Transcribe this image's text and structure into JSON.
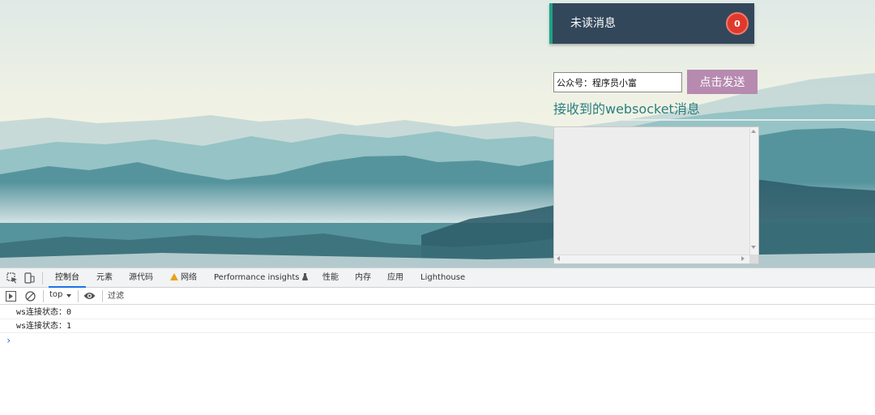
{
  "page": {
    "unread": {
      "label": "未读消息",
      "count": "0"
    },
    "input": {
      "value": "公众号：程序员小富"
    },
    "send_button": "点击发送",
    "received_title": "接收到的websocket消息",
    "message_area": {
      "value": ""
    }
  },
  "devtools": {
    "tabs": [
      {
        "label": "控制台"
      },
      {
        "label": "元素"
      },
      {
        "label": "源代码"
      },
      {
        "label": "网络"
      },
      {
        "label": "Performance insights"
      },
      {
        "label": "性能"
      },
      {
        "label": "内存"
      },
      {
        "label": "应用"
      },
      {
        "label": "Lighthouse"
      }
    ],
    "toolbar": {
      "context": "top",
      "filter_placeholder": "过滤"
    },
    "console_lines": [
      {
        "text": "ws连接状态：0"
      },
      {
        "text": "ws连接状态：1"
      }
    ],
    "prompt": "›"
  },
  "colors": {
    "unread_bar": "#33475b",
    "unread_accent": "#1aa387",
    "badge": "#e0392c",
    "send_button": "#b78ab0",
    "title_text": "#2a7f80",
    "devtools_active_tab": "#1a73e8"
  },
  "icons": {
    "devtools_left": [
      "inspect-element-icon",
      "device-toolbar-icon"
    ],
    "toolbar": [
      "sidebar-toggle-icon",
      "clear-console-icon",
      "eye-icon"
    ],
    "network_tab": "warning-icon",
    "performance_insights_tab": "flask-icon"
  }
}
